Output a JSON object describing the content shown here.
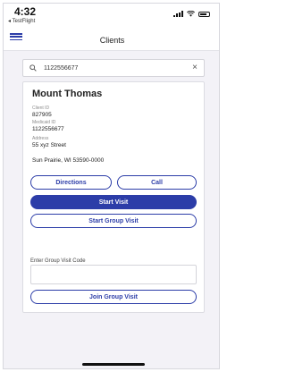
{
  "status_bar": {
    "time": "4:32",
    "back_app": "◂ TestFlight"
  },
  "nav": {
    "title": "Clients",
    "menu_icon": "hamburger-menu-icon"
  },
  "search": {
    "value": "1122556677",
    "placeholder": "",
    "clear_icon": "×"
  },
  "client": {
    "name": "Mount Thomas",
    "client_id_label": "Client ID",
    "client_id": "827905",
    "medicaid_id_label": "Medicaid ID",
    "medicaid_id": "1122556677",
    "address_label": "Address",
    "address_line1": "55 xyz Street",
    "address_line2": "Sun Prairie, WI 53590-0000"
  },
  "actions": {
    "directions": "Directions",
    "call": "Call",
    "start_visit": "Start Visit",
    "start_group_visit": "Start Group Visit",
    "group_code_label": "Enter Group Visit Code",
    "group_code_value": "",
    "join_group_visit": "Join Group Visit"
  },
  "colors": {
    "accent": "#2c3da8",
    "background": "#f3f2f7"
  }
}
